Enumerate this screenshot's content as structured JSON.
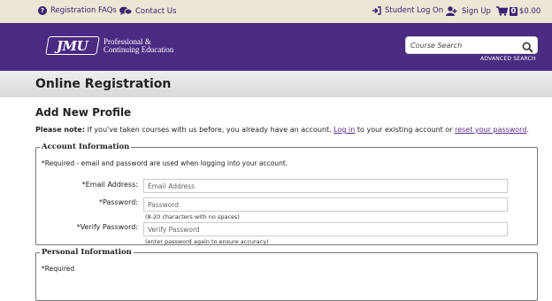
{
  "topbar": {
    "faq_label": "Registration FAQs",
    "contact_label": "Contact Us",
    "login_label": "Student Log On",
    "signup_label": "Sign Up",
    "cart_count": "0",
    "cart_total": "$0.00"
  },
  "header": {
    "logo_text": "JMU",
    "brand_line1": "Professional &",
    "brand_line2": "Continuing Education",
    "search_placeholder": "Course Search",
    "advanced_search_label": "ADVANCED SEARCH"
  },
  "page": {
    "title": "Online Registration",
    "subtitle": "Add New Profile"
  },
  "note": {
    "bold": "Please note:",
    "text1": " If you've taken courses with us before, you already have an account. ",
    "login_link": "Log in",
    "text2": " to your existing account or ",
    "reset_link": "reset your password",
    "text3": "."
  },
  "account": {
    "legend": "Account Information",
    "required_note": "*Required - email and password are used when logging into your account.",
    "email_label": "*Email Address:",
    "email_placeholder": "Email Address",
    "email_value": "",
    "password_label": "*Password:",
    "password_placeholder": "Password",
    "password_hint": "(8-20 characters with no spaces)",
    "verify_label": "*Verify Password:",
    "verify_placeholder": "Verify Password",
    "verify_hint": "(enter password again to ensure accuracy)"
  },
  "personal": {
    "legend": "Personal Information",
    "required_note": "*Required"
  },
  "colors": {
    "brand_purple": "#4b2a82",
    "topbar_bg": "#ece6d6",
    "link_purple": "#5b2d91"
  },
  "icons": [
    "question-circle-icon",
    "chat-bubbles-icon",
    "sign-in-icon",
    "user-plus-icon",
    "cart-icon",
    "magnifier-icon"
  ]
}
